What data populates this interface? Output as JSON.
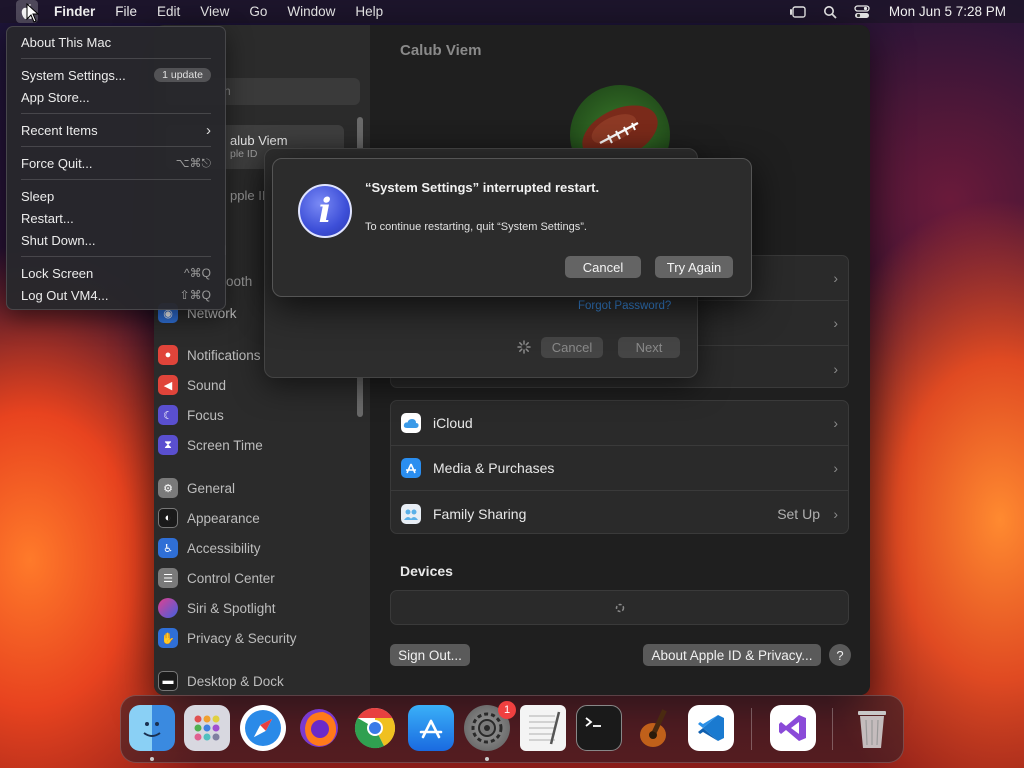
{
  "menubar": {
    "app_name": "Finder",
    "items": [
      "File",
      "Edit",
      "View",
      "Go",
      "Window",
      "Help"
    ],
    "clock": "Mon Jun 5  7:28 PM"
  },
  "apple_menu": {
    "about": "About This Mac",
    "system_settings": "System Settings...",
    "update_badge": "1 update",
    "app_store": "App Store...",
    "recent_items": "Recent Items",
    "force_quit": "Force Quit...",
    "force_quit_shortcut": "⌥⌘⎋",
    "sleep": "Sleep",
    "restart": "Restart...",
    "shut_down": "Shut Down...",
    "lock_screen": "Lock Screen",
    "lock_shortcut": "^⌘Q",
    "log_out": "Log Out VM4...",
    "log_out_shortcut": "⇧⌘Q"
  },
  "sidebar": {
    "search_placeholder": "h",
    "profile_name": "alub Viem",
    "profile_sub": "ple ID",
    "partial_apple": "pple II",
    "partial_l": "l",
    "partial_bluetooth": "ooth",
    "items": [
      {
        "label": "Network",
        "icon": "network-icon",
        "color": "#2f6fd6"
      },
      {
        "label": "Notifications",
        "icon": "bell-icon",
        "color": "#e0443a"
      },
      {
        "label": "Sound",
        "icon": "speaker-icon",
        "color": "#e0443a"
      },
      {
        "label": "Focus",
        "icon": "moon-icon",
        "color": "#5a4fcf"
      },
      {
        "label": "Screen Time",
        "icon": "hourglass-icon",
        "color": "#5a4fcf"
      },
      {
        "label": "General",
        "icon": "gear-icon",
        "color": "#8a8a8a"
      },
      {
        "label": "Appearance",
        "icon": "appearance-icon",
        "color": "#2a2a2a"
      },
      {
        "label": "Accessibility",
        "icon": "accessibility-icon",
        "color": "#2f6fd6"
      },
      {
        "label": "Control Center",
        "icon": "control-center-icon",
        "color": "#8a8a8a"
      },
      {
        "label": "Siri & Spotlight",
        "icon": "siri-icon",
        "color": "#b040c0"
      },
      {
        "label": "Privacy & Security",
        "icon": "hand-icon",
        "color": "#2f6fd6"
      },
      {
        "label": "Desktop & Dock",
        "icon": "dock-icon",
        "color": "#2a2a2a"
      }
    ]
  },
  "content": {
    "title": "Calub Viem",
    "rows_group2": [
      {
        "label": "iCloud",
        "icon": "icloud-icon",
        "value": ""
      },
      {
        "label": "Media & Purchases",
        "icon": "app-store-icon",
        "value": ""
      },
      {
        "label": "Family Sharing",
        "icon": "family-sharing-icon",
        "value": "Set Up"
      }
    ],
    "devices_heading": "Devices",
    "sign_out": "Sign Out...",
    "about_privacy": "About Apple ID & Privacy...",
    "help": "?"
  },
  "sheet": {
    "forgot_password": "Forgot Password?",
    "cancel": "Cancel",
    "next": "Next"
  },
  "alert": {
    "title": "“System Settings” interrupted restart.",
    "message": "To continue restarting, quit “System Settings”.",
    "cancel": "Cancel",
    "try_again": "Try Again"
  },
  "dock": {
    "apps": [
      "Finder",
      "Launchpad",
      "Safari",
      "Firefox",
      "Chrome",
      "App Store",
      "System Settings",
      "TextEdit",
      "Terminal",
      "GarageBand",
      "VS Code",
      "Visual Studio",
      "Trash"
    ],
    "settings_badge": "1"
  }
}
